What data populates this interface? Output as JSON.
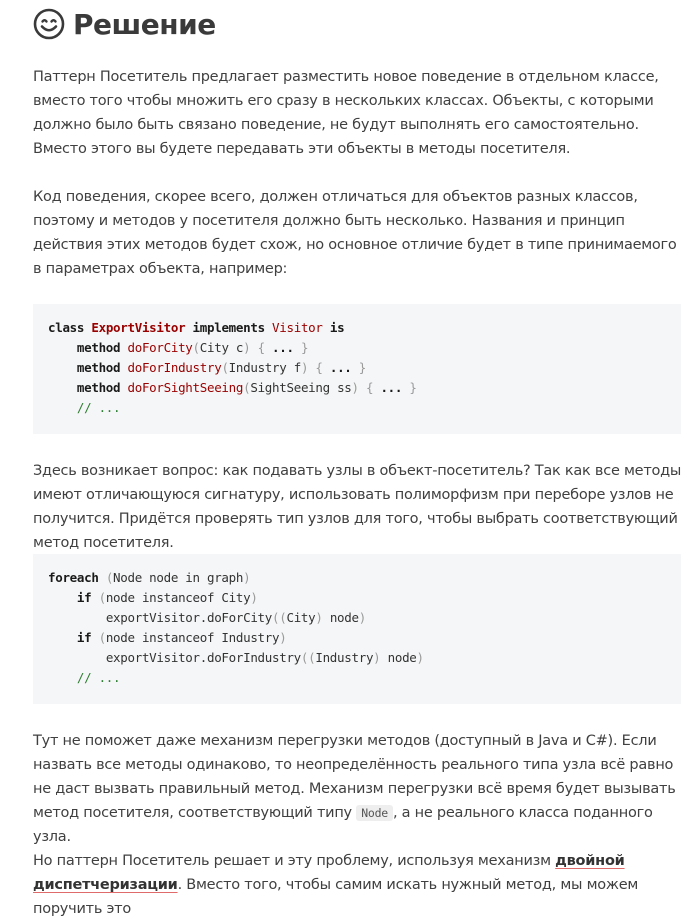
{
  "heading": {
    "icon": "smiley-face-icon",
    "title": "Решение"
  },
  "paragraphs": {
    "p1": "Паттерн Посетитель предлагает разместить новое поведение в отдельном классе, вместо того чтобы множить его сразу в нескольких классах. Объекты, с которыми должно было быть связано поведение, не будут выполнять его самостоятельно. Вместо этого вы будете передавать эти объекты в методы посетителя.",
    "p2": "Код поведения, скорее всего, должен отличаться для объектов разных классов, поэтому и методов у посетителя должно быть несколько. Названия и принцип действия этих методов будет схож, но основное отличие будет в типе принимаемого в параметрах объекта, например:",
    "p3": "Здесь возникает вопрос: как подавать узлы в объект-посетитель? Так как все методы имеют отличающуюся сигнатуру, использовать полиморфизм при переборе узлов не получится. Придётся проверять тип узлов для того, чтобы выбрать соответствующий метод посетителя.",
    "p4_before": "Тут не поможет даже механизм перегрузки методов (доступный в Java и C#). Если назвать все методы одинаково, то неопределённость реального типа узла всё равно не даст вызвать правильный метод. Механизм перегрузки всё время будет вызывать метод посетителя, соответствующий типу ",
    "p4_code": "Node",
    "p4_after": ", а не реального класса поданного узла.",
    "p5_before": "Но паттерн Посетитель решает и эту проблему, используя механизм ",
    "p5_link": "двойной диспетчеризации",
    "p5_after": ". Вместо того, чтобы самим искать нужный метод, мы можем поручить это"
  },
  "code1": {
    "l1": {
      "kw1": "class",
      "name": "ExportVisitor",
      "kw2": "implements",
      "iface": "Visitor",
      "kw3": "is"
    },
    "l2": {
      "kw": "method",
      "fn": "doForCity",
      "p1": "(",
      "arg": "City c",
      "p2": ") { ",
      "dots": "...",
      "p3": " }"
    },
    "l3": {
      "kw": "method",
      "fn": "doForIndustry",
      "p1": "(",
      "arg": "Industry f",
      "p2": ") { ",
      "dots": "...",
      "p3": " }"
    },
    "l4": {
      "kw": "method",
      "fn": "doForSightSeeing",
      "p1": "(",
      "arg": "SightSeeing ss",
      "p2": ") { ",
      "dots": "...",
      "p3": " }"
    },
    "l5": {
      "comment": "// ..."
    }
  },
  "code2": {
    "l1": {
      "kw": "foreach",
      "p1": " (",
      "expr": "Node node in graph",
      "p2": ")"
    },
    "l2": {
      "kw": "if",
      "p1": " (",
      "expr": "node instanceof City",
      "p2": ")"
    },
    "l3": {
      "call": "exportVisitor.doForCity",
      "p1": "((",
      "cast": "City",
      "p2": ")",
      "arg": " node",
      "p3": ")"
    },
    "l4": {
      "kw": "if",
      "p1": " (",
      "expr": "node instanceof Industry",
      "p2": ")"
    },
    "l5": {
      "call": "exportVisitor.doForIndustry",
      "p1": "((",
      "cast": "Industry",
      "p2": ")",
      "arg": " node",
      "p3": ")"
    },
    "l6": {
      "comment": "// ..."
    }
  }
}
